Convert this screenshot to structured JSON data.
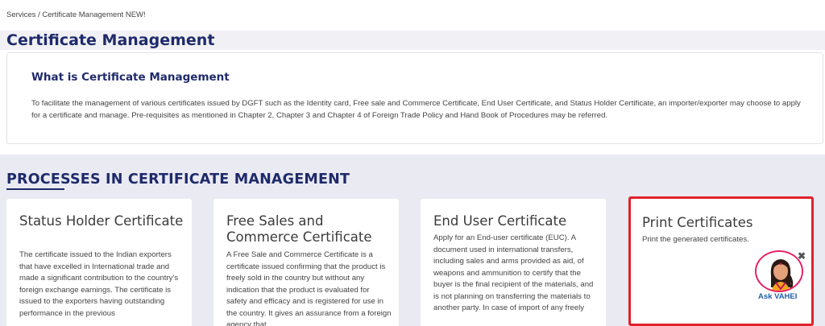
{
  "breadcrumb": "Services / Certificate Management NEW!",
  "page_title": "Certificate Management",
  "info": {
    "heading": "What is Certificate Management",
    "text": "To facilitate the management of various certificates issued by DGFT such as the Identity card, Free sale and Commerce Certificate, End User Certificate, and Status Holder Certificate, an importer/exporter may choose to apply for a certificate and manage. Pre-requisites as mentioned in Chapter 2, Chapter 3 and Chapter 4 of Foreign Trade Policy and Hand Book of Procedures may be referred."
  },
  "processes": {
    "heading": "PROCESSES IN CERTIFICATE MANAGEMENT",
    "cards": [
      {
        "title": "Status Holder Certificate",
        "desc": "The certificate issued to the Indian exporters that have excelled in International trade and made a significant contribution to the country's foreign exchange earnings. The certificate is issued to the exporters having outstanding performance in the previous"
      },
      {
        "title": "Free Sales and Commerce Certificate",
        "desc": "A Free Sale and Commerce Certificate is a certificate issued confirming that the product is freely sold in the country but without any indication that the product is evaluated for safety and efficacy and is registered for use in the country. It gives an assurance from a foreign agency that"
      },
      {
        "title": "End User Certificate",
        "desc": "Apply for an End-user certificate (EUC). A document used in international transfers, including sales and arms provided as aid, of weapons and ammunition to certify that the buyer is the final recipient of the materials, and is not planning on transferring the materials to another party. In case of import of any freely"
      },
      {
        "title": "Print Certificates",
        "desc": "Print the generated certificates."
      }
    ]
  },
  "assistant": {
    "label": "Ask VAHEI",
    "close": "✖"
  },
  "colors": {
    "brand": "#1f2a6b",
    "highlight": "#e0232a",
    "section_bg": "#eaeaf2"
  }
}
